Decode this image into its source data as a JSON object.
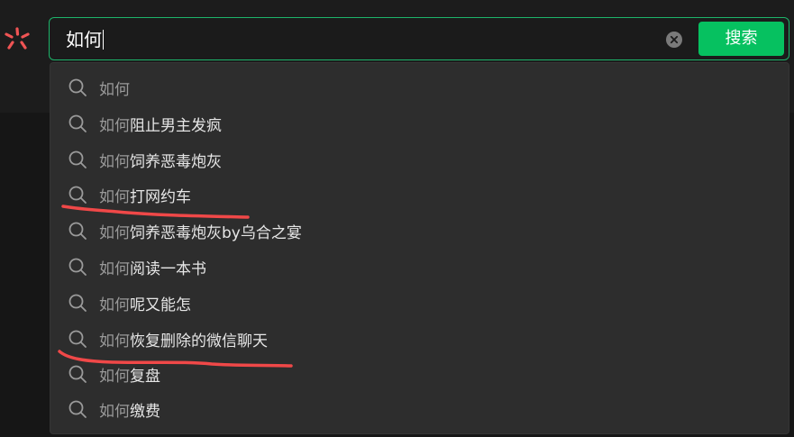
{
  "search": {
    "value": "如何",
    "clear_icon": "clear-circle-icon",
    "button_label": "搜索"
  },
  "colors": {
    "accent": "#06c160",
    "border_focus": "#1db46a",
    "dropdown_bg": "#2d2d2d",
    "annotation": "#f04848"
  },
  "suggestions": [
    {
      "query": "如何",
      "rest": ""
    },
    {
      "query": "如何",
      "rest": "阻止男主发疯"
    },
    {
      "query": "如何",
      "rest": "饲养恶毒炮灰"
    },
    {
      "query": "如何",
      "rest": "打网约车"
    },
    {
      "query": "如何",
      "rest": "饲养恶毒炮灰by乌合之宴"
    },
    {
      "query": "如何",
      "rest": "阅读一本书"
    },
    {
      "query": "如何",
      "rest": "呢又能怎"
    },
    {
      "query": "如何",
      "rest": "恢复删除的微信聊天"
    },
    {
      "query": "如何",
      "rest": "复盘"
    },
    {
      "query": "如何",
      "rest": "缴费"
    }
  ]
}
